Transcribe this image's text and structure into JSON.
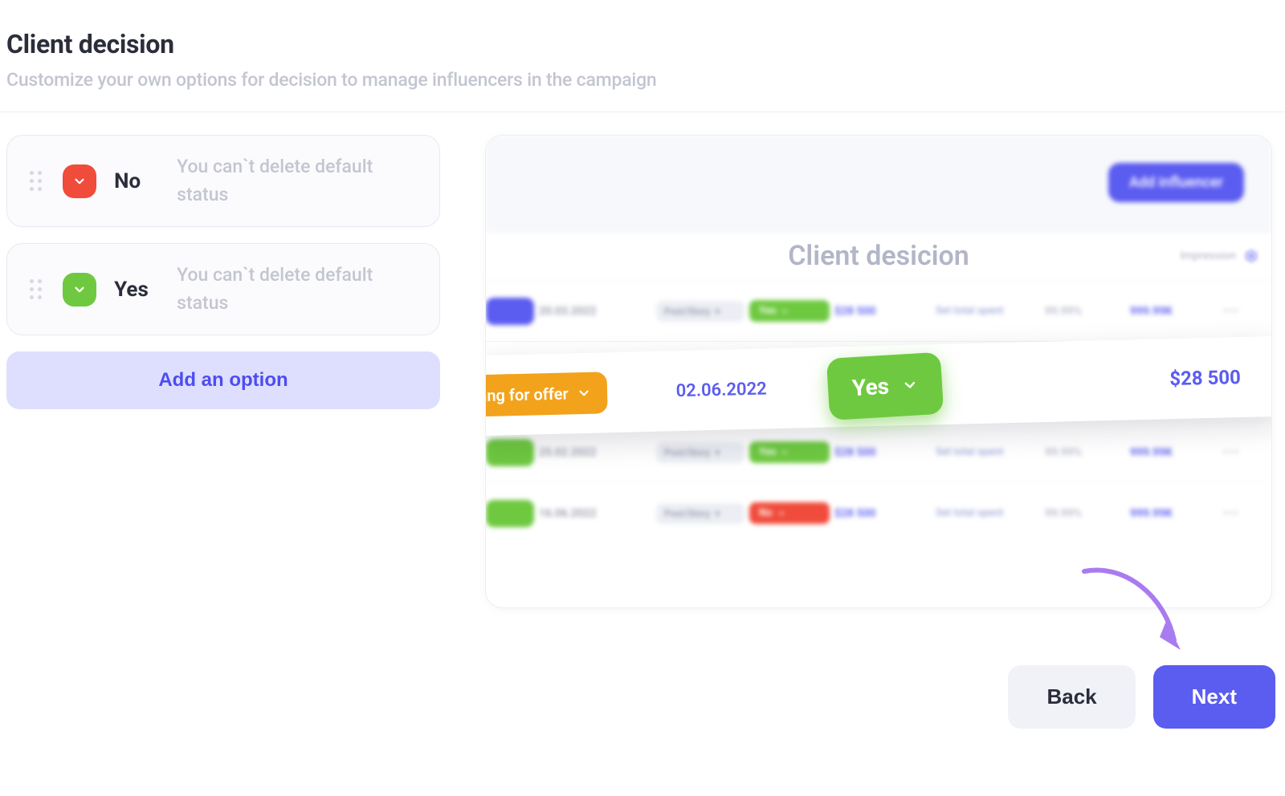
{
  "header": {
    "title": "Client decision",
    "subtitle": "Customize your own options for decision to manage influencers in the campaign"
  },
  "options": [
    {
      "label": "No",
      "hint": "You can`t delete default status",
      "color": "red"
    },
    {
      "label": "Yes",
      "hint": "You can`t delete default status",
      "color": "green"
    }
  ],
  "add_option_label": "Add an option",
  "preview": {
    "add_influencer_label": "Add influencer",
    "column_title": "Client desicion",
    "right_meta_label": "Impression",
    "focus_row": {
      "left_chip": "ing for offer",
      "date": "02.06.2022",
      "decision": "Yes",
      "amount": "$28 500"
    },
    "blurred_rows": [
      {
        "frag": "blue",
        "date": "20.03.2022",
        "post": "Post/Story",
        "decision": "Yes",
        "amount": "$28 500",
        "spent": "Set total spent",
        "pct": "99.99%",
        "k": "999.99K"
      },
      {
        "frag": "green",
        "date": "25.02.2022",
        "post": "Post/Story",
        "decision": "Yes",
        "amount": "$28 500",
        "spent": "Set total spent",
        "pct": "99.99%",
        "k": "999.99K"
      },
      {
        "frag": "green",
        "date": "16.06.2022",
        "post": "Post/Story",
        "decision": "No",
        "amount": "$28 500",
        "spent": "Set total spent",
        "pct": "99.99%",
        "k": "999.99K"
      }
    ]
  },
  "footer": {
    "back_label": "Back",
    "next_label": "Next"
  }
}
